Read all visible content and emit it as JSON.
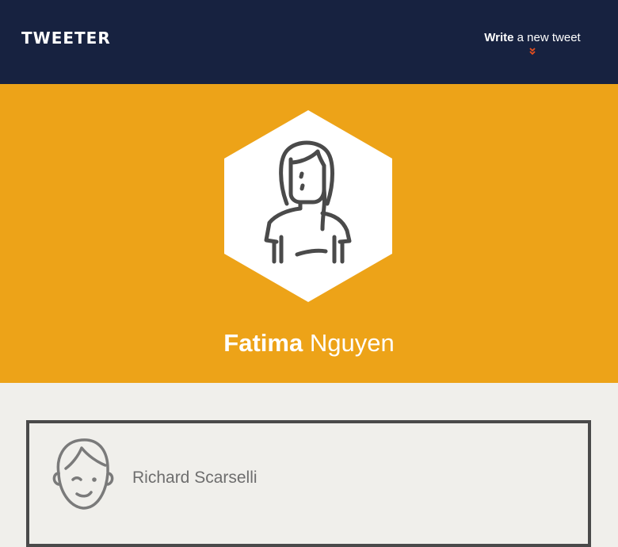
{
  "header": {
    "logo": "TWEETER",
    "compose_strong": "Write",
    "compose_rest": " a new tweet",
    "compose_icon": "double-chevron-down-icon"
  },
  "profile": {
    "first_name": "Fatima",
    "last_name": " Nguyen",
    "avatar_icon": "woman-avatar-icon"
  },
  "tweets": [
    {
      "author": "Richard Scarselli",
      "avatar_icon": "winking-man-avatar-icon"
    }
  ],
  "colors": {
    "header_bg": "#172240",
    "banner_bg": "#eda318",
    "page_bg": "#f0efeb",
    "accent": "#e8501e",
    "card_border": "#4a4a4a"
  }
}
